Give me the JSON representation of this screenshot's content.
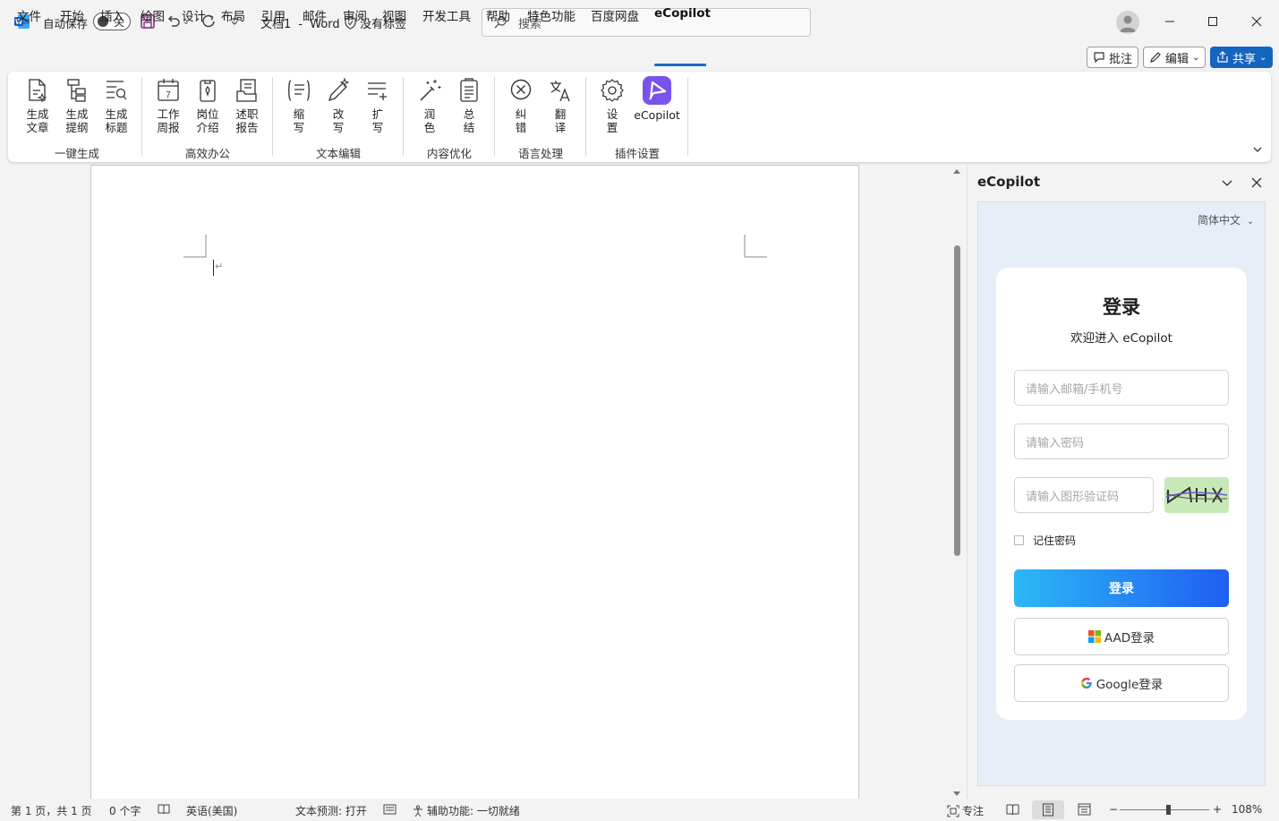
{
  "app": {
    "doc_name": "文档1",
    "separator": "-",
    "app_name": "Word",
    "label_state": "没有标签"
  },
  "autosave": {
    "label": "自动保存",
    "state": "关"
  },
  "search": {
    "placeholder": "搜索"
  },
  "menu_tabs": [
    "文件",
    "开始",
    "插入",
    "绘图",
    "设计",
    "布局",
    "引用",
    "邮件",
    "审阅",
    "视图",
    "开发工具",
    "帮助",
    "特色功能",
    "百度网盘",
    "eCopilot"
  ],
  "active_tab": "eCopilot",
  "right_buttons": {
    "comments": "批注",
    "editing": "编辑",
    "share": "共享"
  },
  "ribbon": {
    "groups": [
      {
        "label": "一键生成",
        "buttons": [
          {
            "line1": "生成",
            "line2": "文章",
            "icon": "doc-sparkle-icon"
          },
          {
            "line1": "生成",
            "line2": "提纲",
            "icon": "outline-icon"
          },
          {
            "line1": "生成",
            "line2": "标题",
            "icon": "title-search-icon"
          }
        ]
      },
      {
        "label": "高效办公",
        "buttons": [
          {
            "line1": "工作",
            "line2": "周报",
            "icon": "calendar-icon"
          },
          {
            "line1": "岗位",
            "line2": "介绍",
            "icon": "badge-icon"
          },
          {
            "line1": "述职",
            "line2": "报告",
            "icon": "report-icon"
          }
        ]
      },
      {
        "label": "文本编辑",
        "buttons": [
          {
            "line1": "缩",
            "line2": "写",
            "icon": "shrink-icon"
          },
          {
            "line1": "改",
            "line2": "写",
            "icon": "rewrite-icon"
          },
          {
            "line1": "扩",
            "line2": "写",
            "icon": "expand-icon"
          }
        ]
      },
      {
        "label": "内容优化",
        "buttons": [
          {
            "line1": "润",
            "line2": "色",
            "icon": "magic-wand-icon"
          },
          {
            "line1": "总",
            "line2": "结",
            "icon": "summary-icon"
          }
        ]
      },
      {
        "label": "语言处理",
        "buttons": [
          {
            "line1": "纠",
            "line2": "错",
            "icon": "correct-icon"
          },
          {
            "line1": "翻",
            "line2": "译",
            "icon": "translate-icon"
          }
        ]
      },
      {
        "label": "插件设置",
        "buttons": [
          {
            "line1": "设",
            "line2": "置",
            "icon": "gear-icon"
          },
          {
            "line1": "eCopilot",
            "line2": "",
            "icon": "ecopilot-logo-icon"
          }
        ]
      }
    ]
  },
  "pane": {
    "title": "eCopilot",
    "language": "简体中文",
    "login_title": "登录",
    "login_subtitle": "欢迎进入 eCopilot",
    "email_placeholder": "请输入邮箱/手机号",
    "password_placeholder": "请输入密码",
    "captcha_placeholder": "请输入图形验证码",
    "remember_label": "记住密码",
    "login_button": "登录",
    "aad_button": "AAD登录",
    "google_button": "Google登录"
  },
  "status": {
    "page": "第 1 页，共 1 页",
    "words": "0 个字",
    "language": "英语(美国)",
    "prediction": "文本预测: 打开",
    "accessibility": "辅助功能: 一切就绪",
    "focus": "专注",
    "zoom": "108%",
    "zoom_level": 0.54
  },
  "colors": {
    "accent": "#1b6dbf",
    "share_bg": "#1565c0",
    "login_grad_start": "#2bb8f5",
    "login_grad_end": "#1f5ef2"
  }
}
